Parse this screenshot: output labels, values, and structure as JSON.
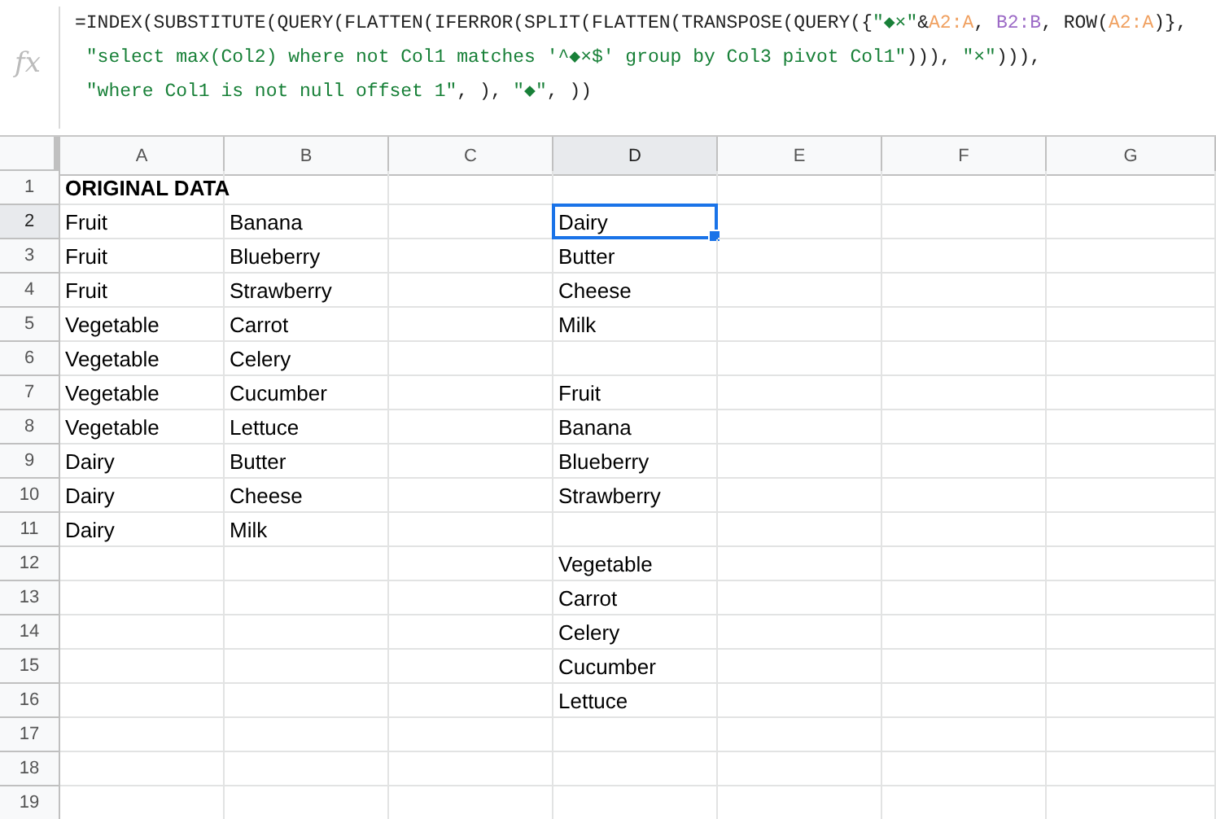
{
  "formula_bar": {
    "icon": "fx",
    "lines": [
      [
        {
          "kind": "plain",
          "text": "=INDEX(SUBSTITUTE(QUERY(FLATTEN(IFERROR(SPLIT(FLATTEN(TRANSPOSE(QUERY({"
        },
        {
          "kind": "string",
          "text": "\"◆×\""
        },
        {
          "kind": "plain",
          "text": "&"
        },
        {
          "kind": "range_1",
          "text": "A2:A"
        },
        {
          "kind": "plain",
          "text": ", "
        },
        {
          "kind": "range_2",
          "text": "B2:B"
        },
        {
          "kind": "plain",
          "text": ", ROW("
        },
        {
          "kind": "range_1",
          "text": "A2:A"
        },
        {
          "kind": "plain",
          "text": ")},"
        }
      ],
      [
        {
          "kind": "string",
          "text": " \"select max(Col2) where not Col1 matches '^◆×$' group by Col3 pivot Col1\""
        },
        {
          "kind": "plain",
          "text": "))), "
        },
        {
          "kind": "string",
          "text": "\"×\""
        },
        {
          "kind": "plain",
          "text": "))),"
        }
      ],
      [
        {
          "kind": "string",
          "text": " \"where Col1 is not null offset 1\""
        },
        {
          "kind": "plain",
          "text": ", ), "
        },
        {
          "kind": "string",
          "text": "\"◆\""
        },
        {
          "kind": "plain",
          "text": ", ))"
        }
      ]
    ]
  },
  "columns": [
    {
      "label": "A",
      "selected": false
    },
    {
      "label": "B",
      "selected": false
    },
    {
      "label": "C",
      "selected": false
    },
    {
      "label": "D",
      "selected": true
    },
    {
      "label": "E",
      "selected": false
    },
    {
      "label": "F",
      "selected": false
    },
    {
      "label": "G",
      "selected": false
    }
  ],
  "rows": [
    {
      "number": "1",
      "selected": false,
      "bold": true,
      "a": "ORIGINAL DATA"
    },
    {
      "number": "2",
      "selected": true,
      "bold": false,
      "a": "Fruit",
      "b": "Banana",
      "d": "Dairy"
    },
    {
      "number": "3",
      "selected": false,
      "bold": false,
      "a": "Fruit",
      "b": "Blueberry",
      "d": "Butter"
    },
    {
      "number": "4",
      "selected": false,
      "bold": false,
      "a": "Fruit",
      "b": "Strawberry",
      "d": "Cheese"
    },
    {
      "number": "5",
      "selected": false,
      "bold": false,
      "a": "Vegetable",
      "b": "Carrot",
      "d": "Milk"
    },
    {
      "number": "6",
      "selected": false,
      "bold": false,
      "a": "Vegetable",
      "b": "Celery"
    },
    {
      "number": "7",
      "selected": false,
      "bold": false,
      "a": "Vegetable",
      "b": "Cucumber",
      "d": "Fruit"
    },
    {
      "number": "8",
      "selected": false,
      "bold": false,
      "a": "Vegetable",
      "b": "Lettuce",
      "d": "Banana"
    },
    {
      "number": "9",
      "selected": false,
      "bold": false,
      "a": "Dairy",
      "b": "Butter",
      "d": "Blueberry"
    },
    {
      "number": "10",
      "selected": false,
      "bold": false,
      "a": "Dairy",
      "b": "Cheese",
      "d": "Strawberry"
    },
    {
      "number": "11",
      "selected": false,
      "bold": false,
      "a": "Dairy",
      "b": "Milk"
    },
    {
      "number": "12",
      "selected": false,
      "bold": false,
      "d": "Vegetable"
    },
    {
      "number": "13",
      "selected": false,
      "bold": false,
      "d": "Carrot"
    },
    {
      "number": "14",
      "selected": false,
      "bold": false,
      "d": "Celery"
    },
    {
      "number": "15",
      "selected": false,
      "bold": false,
      "d": "Cucumber"
    },
    {
      "number": "16",
      "selected": false,
      "bold": false,
      "d": "Lettuce"
    },
    {
      "number": "17",
      "selected": false
    },
    {
      "number": "18",
      "selected": false
    },
    {
      "number": "19",
      "selected": false
    }
  ]
}
